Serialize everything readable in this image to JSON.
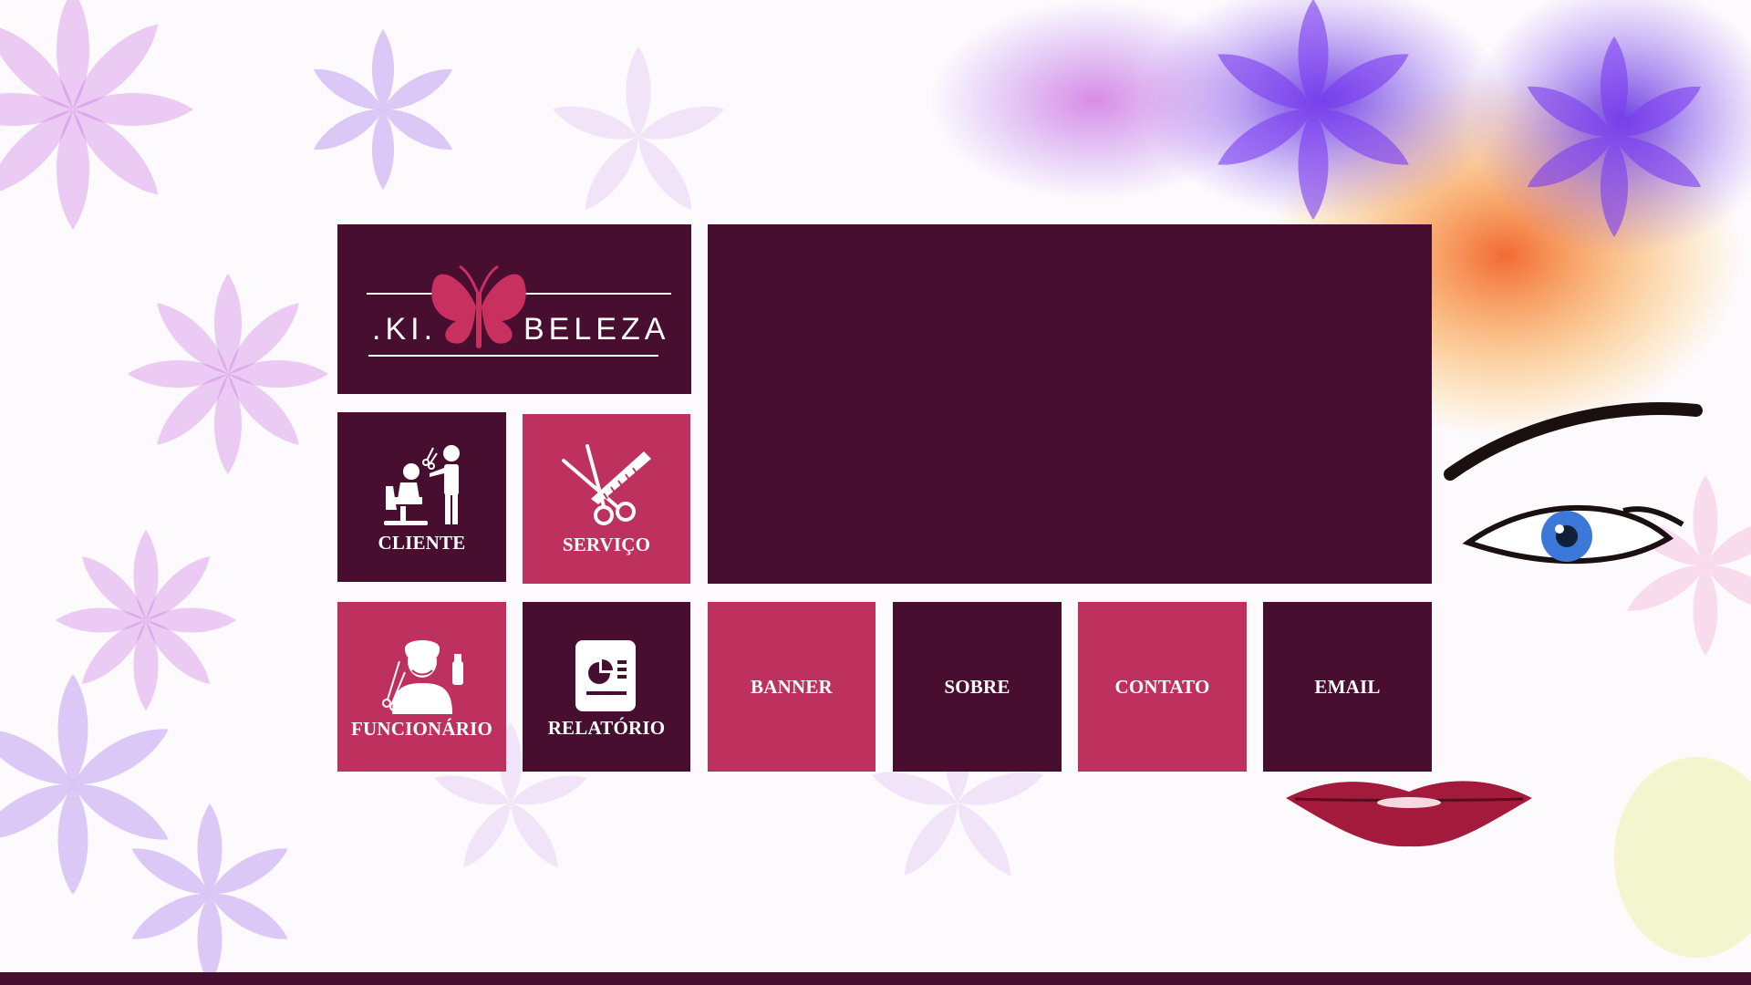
{
  "logo": {
    "left_text": ".KI.",
    "right_text": "BELEZA",
    "icon": "butterfly-icon"
  },
  "tiles": [
    {
      "id": "cliente",
      "label": "CLIENTE",
      "icon": "barber-client-icon",
      "color": "#480e30"
    },
    {
      "id": "servico",
      "label": "SERVIÇO",
      "icon": "scissors-comb-icon",
      "color": "#be305e"
    },
    {
      "id": "funcionario",
      "label": "FUNCIONÁRIO",
      "icon": "stylist-icon",
      "color": "#be305e"
    },
    {
      "id": "relatorio",
      "label": "RELATÓRIO",
      "icon": "report-chart-icon",
      "color": "#480e30"
    },
    {
      "id": "banner",
      "label": "BANNER",
      "color": "#be305e"
    },
    {
      "id": "sobre",
      "label": "SOBRE",
      "color": "#480e30"
    },
    {
      "id": "contato",
      "label": "CONTATO",
      "color": "#be305e"
    },
    {
      "id": "email",
      "label": "EMAIL",
      "color": "#480e30"
    }
  ],
  "colors": {
    "dark": "#480e30",
    "pink": "#be305e",
    "accent_logo": "#c8305f"
  }
}
